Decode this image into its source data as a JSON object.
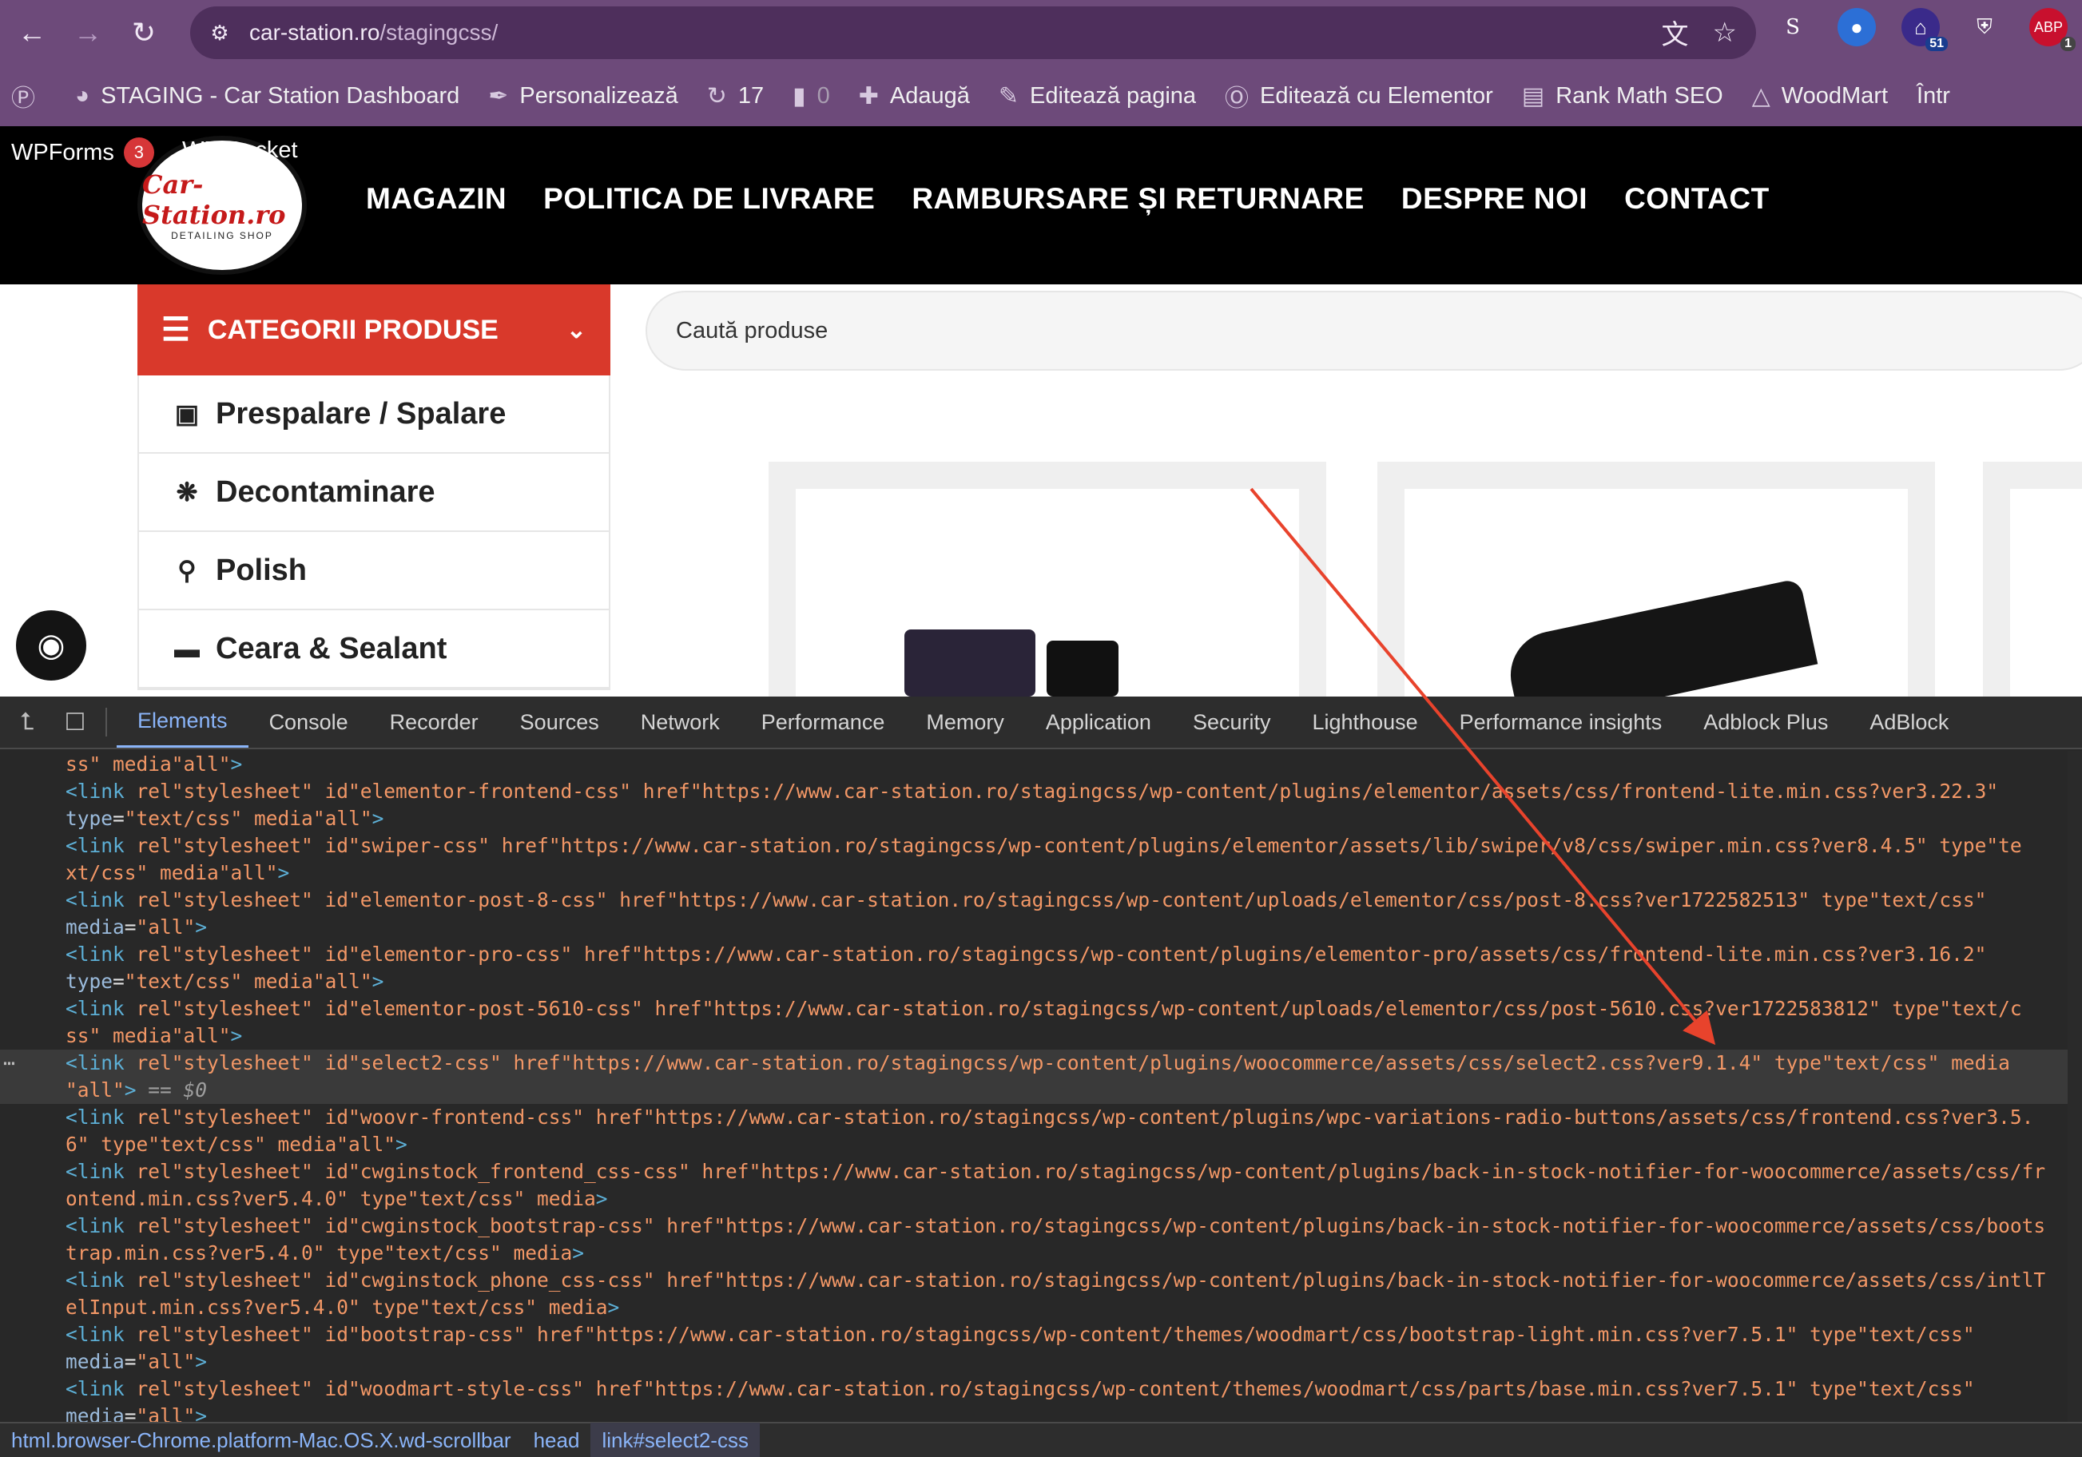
{
  "browser": {
    "url_host": "car-station.ro",
    "url_path": "/stagingcss/",
    "extension_counts": [
      "51",
      "1"
    ]
  },
  "wp_admin_bar": {
    "site_name": "STAGING - Car Station Dashboard",
    "customize": "Personalizează",
    "updates_count": "17",
    "comments_count": "0",
    "add_new": "Adaugă",
    "edit_page": "Editează pagina",
    "edit_elementor": "Editează cu Elementor",
    "rank_math": "Rank Math SEO",
    "woodmart": "WoodMart",
    "overflow": "Într"
  },
  "site_header": {
    "wpforms_label": "WPForms",
    "wpforms_badge": "3",
    "wprocket_label": "WP Rocket",
    "logo_text": "Car-Station.ro",
    "logo_sub": "DETAILING SHOP",
    "nav": [
      "MAGAZIN",
      "POLITICA DE LIVRARE",
      "RAMBURSARE ȘI RETURNARE",
      "DESPRE NOI",
      "CONTACT"
    ]
  },
  "categories": {
    "header": "CATEGORII PRODUSE",
    "items": [
      "Prespalare / Spalare",
      "Decontaminare",
      "Polish",
      "Ceara & Sealant"
    ]
  },
  "search": {
    "placeholder": "Caută produse"
  },
  "devtools": {
    "tabs": [
      "Elements",
      "Console",
      "Recorder",
      "Sources",
      "Network",
      "Performance",
      "Memory",
      "Application",
      "Security",
      "Lighthouse",
      "Performance insights",
      "Adblock Plus",
      "AdBlock"
    ],
    "active_tab": "Elements",
    "breadcrumbs": [
      "html.browser-Chrome.platform-Mac.OS.X.wd-scrollbar",
      "head",
      "link#select2-css"
    ],
    "lines": [
      {
        "t": "ss\" media=\"all\">"
      },
      {
        "t": "<link rel=\"stylesheet\" id=\"elementor-frontend-css\" href=\"https://www.car-station.ro/stagingcss/wp-content/plugins/elementor/assets/css/frontend-lite.min.css?ver=3.22.3\""
      },
      {
        "t": "type=\"text/css\" media=\"all\">"
      },
      {
        "t": "<link rel=\"stylesheet\" id=\"swiper-css\" href=\"https://www.car-station.ro/stagingcss/wp-content/plugins/elementor/assets/lib/swiper/v8/css/swiper.min.css?ver=8.4.5\" type=\"te"
      },
      {
        "t": "xt/css\" media=\"all\">"
      },
      {
        "t": "<link rel=\"stylesheet\" id=\"elementor-post-8-css\" href=\"https://www.car-station.ro/stagingcss/wp-content/uploads/elementor/css/post-8.css?ver=1722582513\" type=\"text/css\""
      },
      {
        "t": "media=\"all\">"
      },
      {
        "t": "<link rel=\"stylesheet\" id=\"elementor-pro-css\" href=\"https://www.car-station.ro/stagingcss/wp-content/plugins/elementor-pro/assets/css/frontend-lite.min.css?ver=3.16.2\""
      },
      {
        "t": "type=\"text/css\" media=\"all\">"
      },
      {
        "t": "<link rel=\"stylesheet\" id=\"elementor-post-5610-css\" href=\"https://www.car-station.ro/stagingcss/wp-content/uploads/elementor/css/post-5610.css?ver=1722583812\" type=\"text/c"
      },
      {
        "t": "ss\" media=\"all\">"
      },
      {
        "t": "<link rel=\"stylesheet\" id=\"select2-css\" href=\"https://www.car-station.ro/stagingcss/wp-content/plugins/woocommerce/assets/css/select2.css?ver=9.1.4\" type=\"text/css\" media="
      },
      {
        "t": "\"all\"> == $0"
      },
      {
        "t": "<link rel=\"stylesheet\" id=\"woovr-frontend-css\" href=\"https://www.car-station.ro/stagingcss/wp-content/plugins/wpc-variations-radio-buttons/assets/css/frontend.css?ver=3.5."
      },
      {
        "t": "6\" type=\"text/css\" media=\"all\">"
      },
      {
        "t": "<link rel=\"stylesheet\" id=\"cwginstock_frontend_css-css\" href=\"https://www.car-station.ro/stagingcss/wp-content/plugins/back-in-stock-notifier-for-woocommerce/assets/css/fr"
      },
      {
        "t": "ontend.min.css?ver=5.4.0\" type=\"text/css\" media>"
      },
      {
        "t": "<link rel=\"stylesheet\" id=\"cwginstock_bootstrap-css\" href=\"https://www.car-station.ro/stagingcss/wp-content/plugins/back-in-stock-notifier-for-woocommerce/assets/css/boots"
      },
      {
        "t": "trap.min.css?ver=5.4.0\" type=\"text/css\" media>"
      },
      {
        "t": "<link rel=\"stylesheet\" id=\"cwginstock_phone_css-css\" href=\"https://www.car-station.ro/stagingcss/wp-content/plugins/back-in-stock-notifier-for-woocommerce/assets/css/intlT"
      },
      {
        "t": "elInput.min.css?ver=5.4.0\" type=\"text/css\" media>"
      },
      {
        "t": "<link rel=\"stylesheet\" id=\"bootstrap-css\" href=\"https://www.car-station.ro/stagingcss/wp-content/themes/woodmart/css/bootstrap-light.min.css?ver=7.5.1\" type=\"text/css\""
      },
      {
        "t": "media=\"all\">"
      },
      {
        "t": "<link rel=\"stylesheet\" id=\"woodmart-style-css\" href=\"https://www.car-station.ro/stagingcss/wp-content/themes/woodmart/css/parts/base.min.css?ver=7.5.1\" type=\"text/css\""
      },
      {
        "t": "media=\"all\">"
      }
    ],
    "selected_line_index": 11,
    "highlight_text": "9.1.4",
    "colors": {
      "tag": "#5db0d7",
      "attr": "#9bbbdc",
      "val": "#f29766",
      "highlight": "#7a5a00"
    }
  }
}
